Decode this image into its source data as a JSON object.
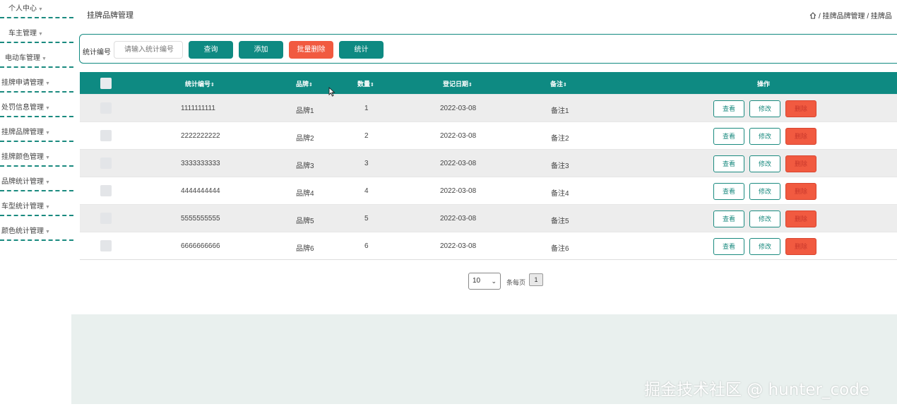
{
  "sidebar": {
    "items": [
      {
        "label": "个人中心"
      },
      {
        "label": "车主管理"
      },
      {
        "label": "电动车管理"
      },
      {
        "label": "挂牌申请管理"
      },
      {
        "label": "处罚信息管理"
      },
      {
        "label": "挂牌品牌管理"
      },
      {
        "label": "挂牌颜色管理"
      },
      {
        "label": "品牌统计管理"
      },
      {
        "label": "车型统计管理"
      },
      {
        "label": "颜色统计管理"
      }
    ]
  },
  "header": {
    "title": "挂牌品牌管理",
    "breadcrumb": "/ 挂牌品牌管理 / 挂牌品"
  },
  "search": {
    "label": "统计编号",
    "placeholder": "请输入统计编号",
    "query_label": "查询",
    "add_label": "添加",
    "batch_delete_label": "批量删除",
    "stats_label": "统计"
  },
  "table": {
    "columns": {
      "code": "统计编号",
      "brand": "品牌",
      "count": "数量",
      "date": "登记日期",
      "note": "备注",
      "actions": "操作"
    },
    "sort_glyph": "⇕",
    "rows": [
      {
        "code": "1111111111",
        "brand": "品牌1",
        "count": "1",
        "date": "2022-03-08",
        "note": "备注1"
      },
      {
        "code": "2222222222",
        "brand": "品牌2",
        "count": "2",
        "date": "2022-03-08",
        "note": "备注2"
      },
      {
        "code": "3333333333",
        "brand": "品牌3",
        "count": "3",
        "date": "2022-03-08",
        "note": "备注3"
      },
      {
        "code": "4444444444",
        "brand": "品牌4",
        "count": "4",
        "date": "2022-03-08",
        "note": "备注4"
      },
      {
        "code": "5555555555",
        "brand": "品牌5",
        "count": "5",
        "date": "2022-03-08",
        "note": "备注5"
      },
      {
        "code": "6666666666",
        "brand": "品牌6",
        "count": "6",
        "date": "2022-03-08",
        "note": "备注6"
      }
    ],
    "view_label": "查看",
    "edit_label": "修改",
    "delete_label": "删除"
  },
  "pagination": {
    "page_size": "10",
    "per_page_label": "条每页",
    "current_page": "1"
  },
  "watermark": "掘金技术社区 @ hunter_code",
  "colors": {
    "primary": "#0e8a82",
    "danger": "#f15a40",
    "bottom_bg": "#e9f0ee"
  }
}
